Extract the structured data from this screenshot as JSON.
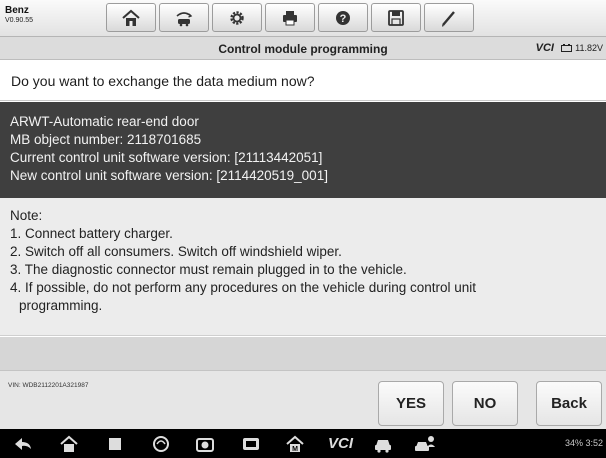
{
  "app": {
    "brand": "Benz",
    "version": "V0.90.55"
  },
  "toolbar": {
    "buttons": [
      {
        "name": "home-icon"
      },
      {
        "name": "vehicle-swap-icon"
      },
      {
        "name": "settings-gear-icon"
      },
      {
        "name": "print-icon"
      },
      {
        "name": "help-icon"
      },
      {
        "name": "save-icon"
      },
      {
        "name": "pen-icon"
      }
    ]
  },
  "titlebar": {
    "title": "Control module programming",
    "vci": "VCI",
    "battery": "11.82V"
  },
  "question": "Do you want to exchange the data medium now?",
  "info": {
    "lines": [
      "ARWT-Automatic rear-end door",
      "MB object number: 2118701685",
      "Current control unit software version: [21113442051]",
      "New control unit software version: [2114420519_001]"
    ]
  },
  "note": {
    "lines": [
      "Note:",
      "1. Connect battery charger.",
      "2. Switch off all consumers. Switch off windshield wiper.",
      "3. The diagnostic connector must remain plugged in to the vehicle.",
      "4. If possible, do not perform any procedures on the vehicle during control unit",
      "programming."
    ]
  },
  "footer": {
    "vin": "VIN: WDB2112201A321987",
    "yes": "YES",
    "no": "NO",
    "back": "Back"
  },
  "sysbar": {
    "vcl": "VCI",
    "status": "34% 3:52"
  },
  "colors": {
    "info_bg": "#3f3f3f",
    "note_bg": "#ececec",
    "toolbar_bg": "#e2e2e2"
  }
}
